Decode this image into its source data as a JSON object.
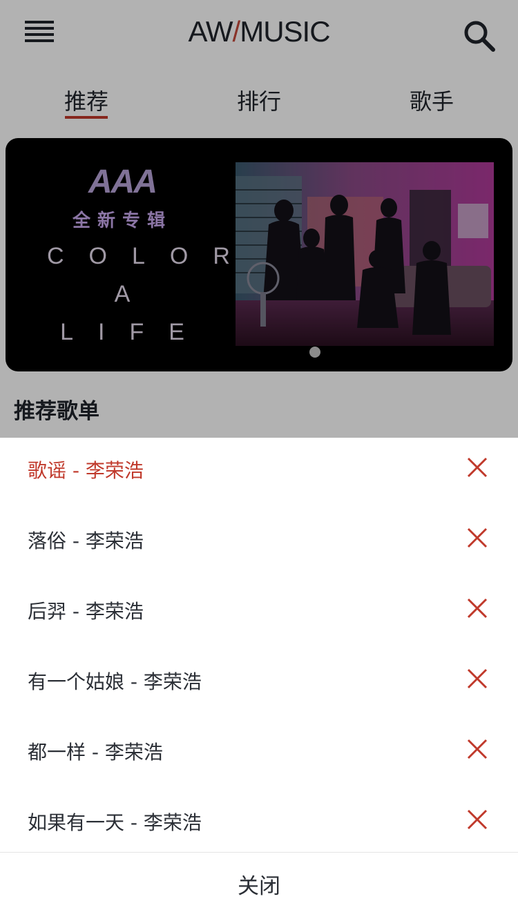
{
  "header": {
    "title_left": "AW",
    "title_slash": "/",
    "title_right": "MUSIC",
    "menu_icon": "hamburger-menu-icon",
    "search_icon": "search-icon"
  },
  "tabs": [
    {
      "label": "推荐",
      "active": true
    },
    {
      "label": "排行",
      "active": false
    },
    {
      "label": "歌手",
      "active": false
    }
  ],
  "banner": {
    "logo": "AAA",
    "subtitle": "全新专辑",
    "lines": [
      "COLOR",
      "A",
      "LIFE"
    ],
    "page_count": 1,
    "current_page": 1
  },
  "section": {
    "title": "推荐歌单"
  },
  "playlist_sheet": {
    "songs": [
      {
        "title": "歌谣 - 李荣浩",
        "current": true
      },
      {
        "title": "落俗 - 李荣浩",
        "current": false
      },
      {
        "title": "后羿 - 李荣浩",
        "current": false
      },
      {
        "title": "有一个姑娘 - 李荣浩",
        "current": false
      },
      {
        "title": "都一样 - 李荣浩",
        "current": false
      },
      {
        "title": "如果有一天 - 李荣浩",
        "current": false
      }
    ],
    "remove_icon": "close-x-icon",
    "close_label": "关闭"
  },
  "colors": {
    "accent": "#c0392b",
    "text": "#2b2f36",
    "overlay": "rgba(0,0,0,0.3)",
    "banner_bg": "#000000"
  }
}
